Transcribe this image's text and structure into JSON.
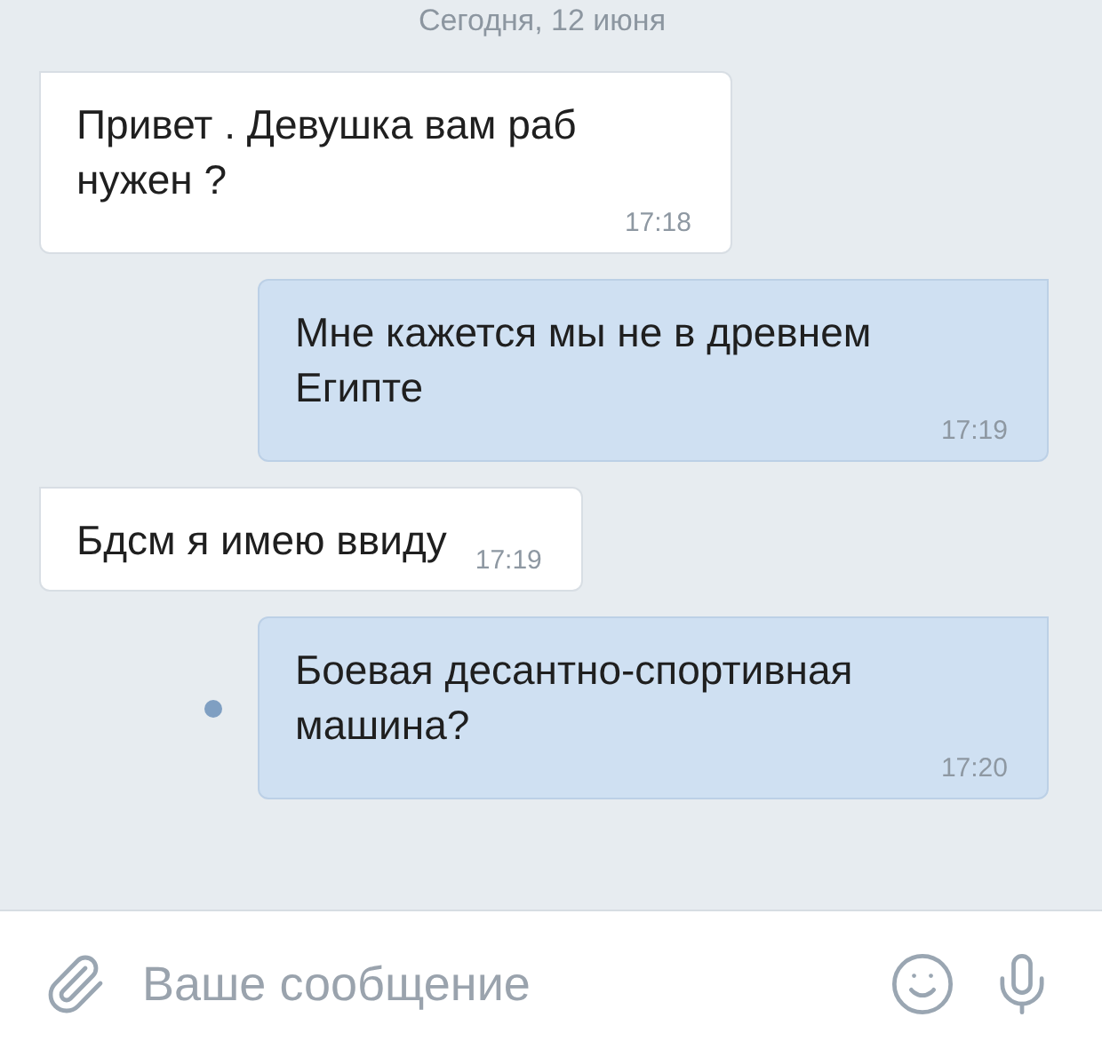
{
  "date_header": "Сегодня, 12 июня",
  "messages": [
    {
      "kind": "incoming",
      "text": "Привет . Девушка вам раб нужен ?",
      "time": "17:18",
      "unread": false
    },
    {
      "kind": "outgoing",
      "text": "Мне кажется мы не в древнем Египте",
      "time": "17:19",
      "unread": false
    },
    {
      "kind": "incoming",
      "text": "Бдсм я имею ввиду",
      "time": "17:19",
      "unread": false
    },
    {
      "kind": "outgoing",
      "text": "Боевая десантно-спортивная машина?",
      "time": "17:20",
      "unread": true
    }
  ],
  "composer": {
    "placeholder": "Ваше сообщение"
  }
}
